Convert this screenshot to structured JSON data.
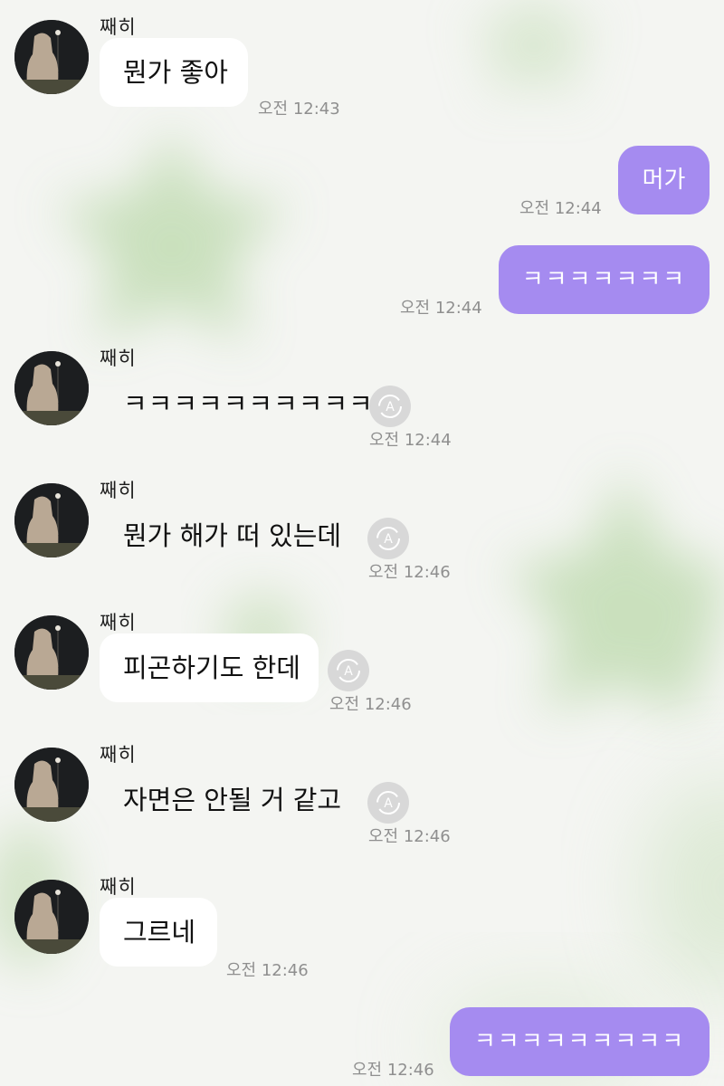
{
  "contact": {
    "name": "째히"
  },
  "colors": {
    "sent_bubble": "#a58bf0",
    "received_bubble": "#ffffff",
    "timestamp": "#8f8f8f"
  },
  "messages": [
    {
      "direction": "in",
      "sender": "째히",
      "text": "뭔가 좋아",
      "time": "오전 12:43",
      "translate_icon": false
    },
    {
      "direction": "out",
      "text": "머가",
      "time": "오전 12:44"
    },
    {
      "direction": "out",
      "text": "ㅋㅋㅋㅋㅋㅋㅋ",
      "time": "오전 12:44"
    },
    {
      "direction": "in",
      "sender": "째히",
      "text": "ㅋㅋㅋㅋㅋㅋㅋㅋㅋㅋ",
      "time": "오전 12:44",
      "translate_icon": true
    },
    {
      "direction": "in",
      "sender": "째히",
      "text": "뭔가 해가 떠 있는데",
      "time": "오전 12:46",
      "translate_icon": true
    },
    {
      "direction": "in",
      "sender": "째히",
      "text": "피곤하기도 한데",
      "time": "오전 12:46",
      "translate_icon": true
    },
    {
      "direction": "in",
      "sender": "째히",
      "text": "자면은 안될 거 같고",
      "time": "오전 12:46",
      "translate_icon": true
    },
    {
      "direction": "in",
      "sender": "째히",
      "text": "그르네",
      "time": "오전 12:46",
      "translate_icon": false
    },
    {
      "direction": "out",
      "text": "ㅋㅋㅋㅋㅋㅋㅋㅋㅋ",
      "time": "오전 12:46"
    }
  ]
}
